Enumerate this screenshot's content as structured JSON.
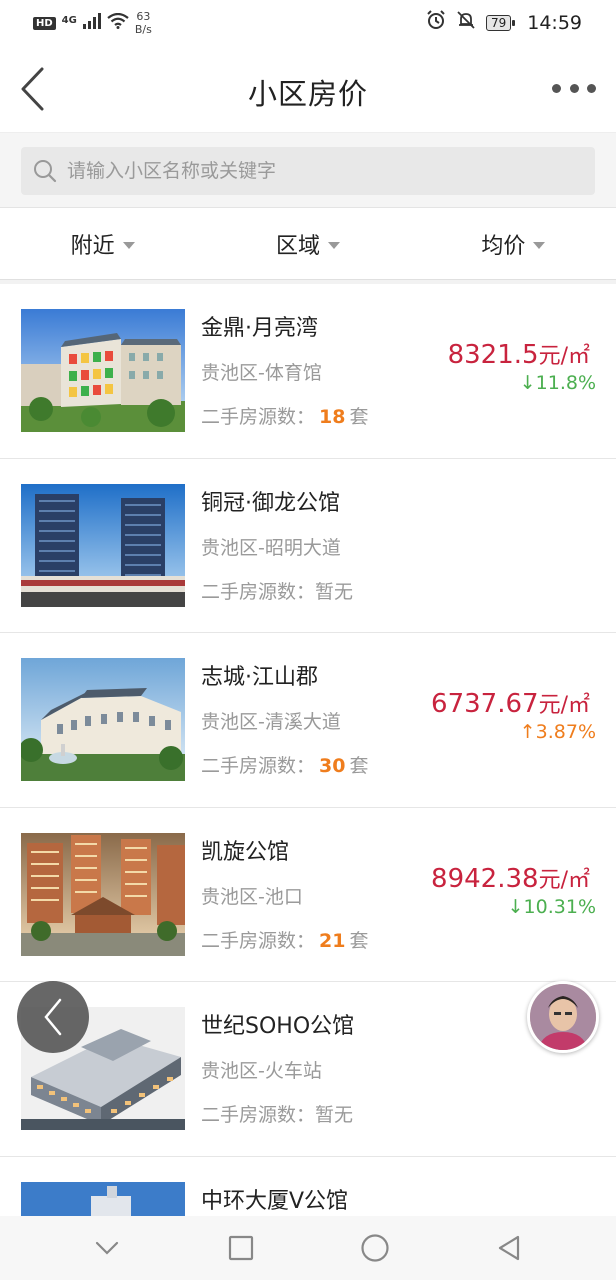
{
  "status_bar": {
    "hd": "HD",
    "network": "4G",
    "speed_value": "63",
    "speed_unit": "B/s",
    "battery": "79",
    "time": "14:59"
  },
  "header": {
    "title": "小区房价"
  },
  "search": {
    "placeholder": "请输入小区名称或关键字"
  },
  "filters": [
    {
      "label": "附近"
    },
    {
      "label": "区域"
    },
    {
      "label": "均价"
    }
  ],
  "listings": [
    {
      "name": "金鼎·月亮湾",
      "district": "贵池区-体育馆",
      "source_label": "二手房源数：",
      "source_count": "18",
      "source_unit": "套",
      "price": "8321.5",
      "price_unit": "元/㎡",
      "change": "↓11.8%",
      "change_dir": "down"
    },
    {
      "name": "铜冠·御龙公馆",
      "district": "贵池区-昭明大道",
      "source_label": "二手房源数：",
      "source_none": "暂无"
    },
    {
      "name": "志城·江山郡",
      "district": "贵池区-清溪大道",
      "source_label": "二手房源数：",
      "source_count": "30",
      "source_unit": "套",
      "price": "6737.67",
      "price_unit": "元/㎡",
      "change": "↑3.87%",
      "change_dir": "up"
    },
    {
      "name": "凯旋公馆",
      "district": "贵池区-池口",
      "source_label": "二手房源数：",
      "source_count": "21",
      "source_unit": "套",
      "price": "8942.38",
      "price_unit": "元/㎡",
      "change": "↓10.31%",
      "change_dir": "down"
    },
    {
      "name": "世纪SOHO公馆",
      "district": "贵池区-火车站",
      "source_label": "二手房源数：",
      "source_none": "暂无"
    },
    {
      "name": "中环大厦V公馆"
    }
  ],
  "colors": {
    "price": "#c8233e",
    "down": "#4caf50",
    "up": "#ef7d1d",
    "count": "#ef7d1d"
  },
  "icons": {
    "back": "chevron-left-icon",
    "more": "more-dots-icon",
    "search": "search-icon",
    "nav": [
      "chevron-down-icon",
      "square-icon",
      "circle-icon",
      "triangle-back-icon"
    ]
  }
}
